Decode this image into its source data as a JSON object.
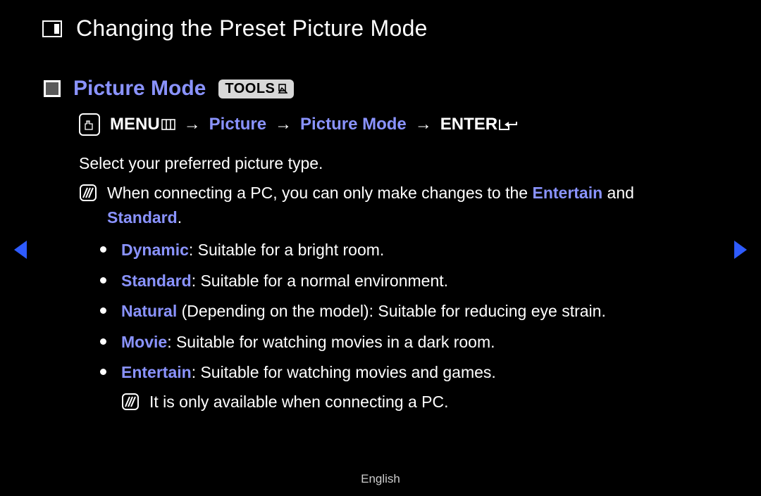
{
  "title": "Changing the Preset Picture Mode",
  "section_title": "Picture Mode",
  "tools_label": "TOOLS",
  "nav": {
    "menu": "MENU",
    "p1": "Picture",
    "p2": "Picture Mode",
    "enter": "ENTER",
    "arrow": "→"
  },
  "intro": "Select your preferred picture type.",
  "note": {
    "pre": "When connecting a PC, you can only make changes to the ",
    "hl1": "Entertain",
    "mid": " and ",
    "hl2": "Standard",
    "post": "."
  },
  "modes": {
    "dynamic": {
      "name": "Dynamic",
      "desc": ": Suitable for a bright room."
    },
    "standard": {
      "name": "Standard",
      "desc": ": Suitable for a normal environment."
    },
    "natural": {
      "name": "Natural",
      "desc": " (Depending on the model): Suitable for reducing eye strain."
    },
    "movie": {
      "name": "Movie",
      "desc": ": Suitable for watching movies in a dark room."
    },
    "entertain": {
      "name": "Entertain",
      "desc": ": Suitable for watching movies and games."
    }
  },
  "sub_note": "It is only available when connecting a PC.",
  "language": "English"
}
